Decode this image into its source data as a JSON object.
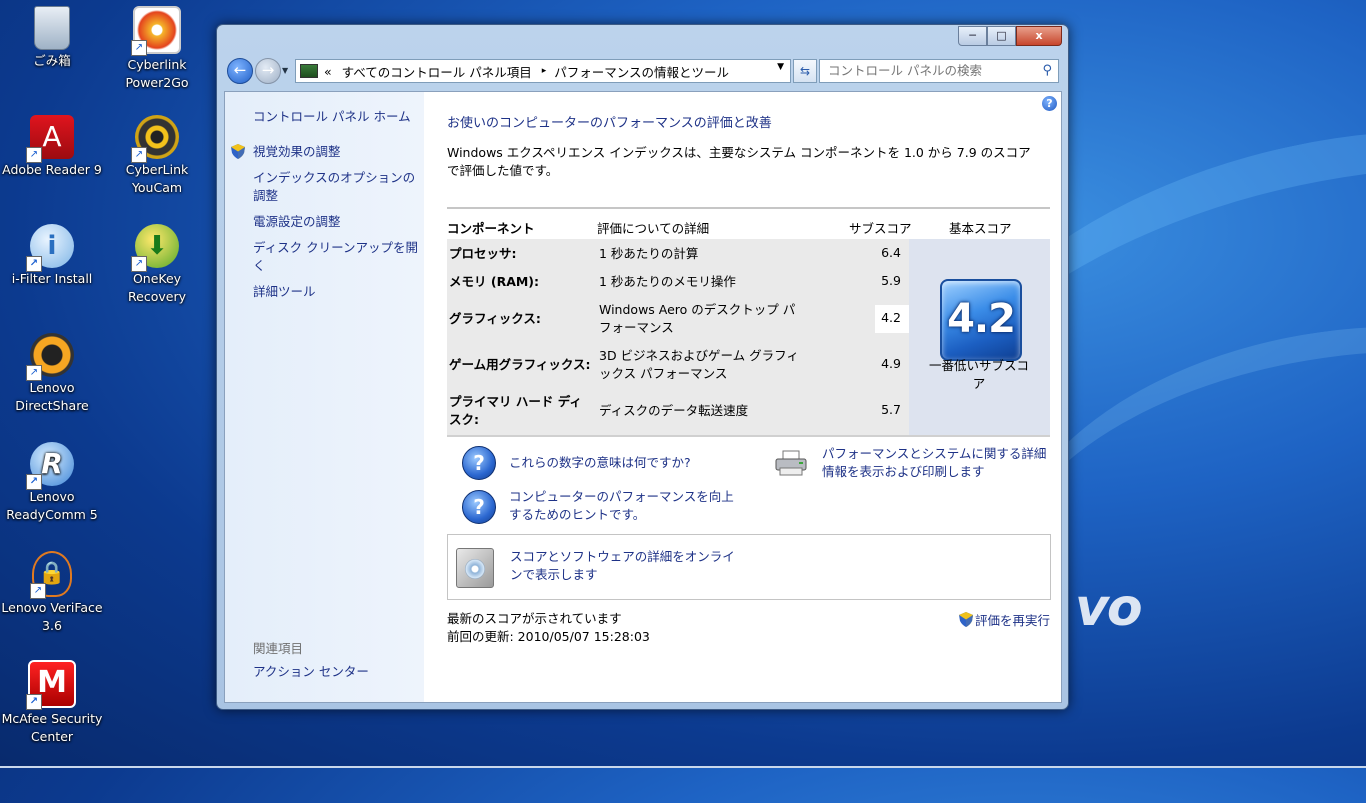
{
  "desktop": {
    "icons": [
      {
        "label": "ごみ箱"
      },
      {
        "label": "Cyberlink Power2Go"
      },
      {
        "label": "Adobe Reader 9"
      },
      {
        "label": "CyberLink YouCam"
      },
      {
        "label": "i-Filter Install"
      },
      {
        "label": "OneKey Recovery"
      },
      {
        "label": "Lenovo DirectShare"
      },
      {
        "label": "Lenovo ReadyComm 5"
      },
      {
        "label": "Lenovo VeriFace 3.6"
      },
      {
        "label": "McAfee Security Center"
      }
    ],
    "brand_text": "vo"
  },
  "window": {
    "caption_buttons": {
      "minimize": "─",
      "maximize": "□",
      "close": "x"
    },
    "address": {
      "prefix": "«",
      "crumbs": [
        "すべてのコントロール パネル項目",
        "パフォーマンスの情報とツール"
      ]
    },
    "search": {
      "placeholder": "コントロール パネルの検索"
    },
    "left_pane": {
      "home": "コントロール パネル ホーム",
      "links": [
        "視覚効果の調整",
        "インデックスのオプションの調整",
        "電源設定の調整",
        "ディスク クリーンアップを開く",
        "詳細ツール"
      ],
      "related_header": "関連項目",
      "related_links": [
        "アクション センター"
      ]
    },
    "main": {
      "help": "?",
      "title": "お使いのコンピューターのパフォーマンスの評価と改善",
      "description": "Windows エクスペリエンス インデックスは、主要なシステム コンポーネントを 1.0 から 7.9 のスコアで評価した値です。",
      "table": {
        "headers": {
          "component": "コンポーネント",
          "detail": "評価についての詳細",
          "subscore": "サブスコア",
          "basescore": "基本スコア"
        },
        "rows": [
          {
            "component": "プロセッサ:",
            "detail": "1 秒あたりの計算",
            "subscore": "6.4"
          },
          {
            "component": "メモリ (RAM):",
            "detail": "1 秒あたりのメモリ操作",
            "subscore": "5.9"
          },
          {
            "component": "グラフィックス:",
            "detail": "Windows Aero のデスクトップ パフォーマンス",
            "subscore": "4.2"
          },
          {
            "component": "ゲーム用グラフィックス:",
            "detail": "3D ビジネスおよびゲーム グラフィックス パフォーマンス",
            "subscore": "4.9"
          },
          {
            "component": "プライマリ ハード ディスク:",
            "detail": "ディスクのデータ転送速度",
            "subscore": "5.7"
          }
        ],
        "base_score": "4.2",
        "base_caption": "一番低いサブスコア"
      },
      "links": {
        "meaning": "これらの数字の意味は何ですか?",
        "tips": "コンピューターのパフォーマンスを向上するためのヒントです。",
        "print": "パフォーマンスとシステムに関する詳細情報を表示および印刷します",
        "online": "スコアとソフトウェアの詳細をオンラインで表示します"
      },
      "status": {
        "line1": "最新のスコアが示されています",
        "line2": "前回の更新: 2010/05/07 15:28:03"
      },
      "rerun": "評価を再実行"
    }
  }
}
